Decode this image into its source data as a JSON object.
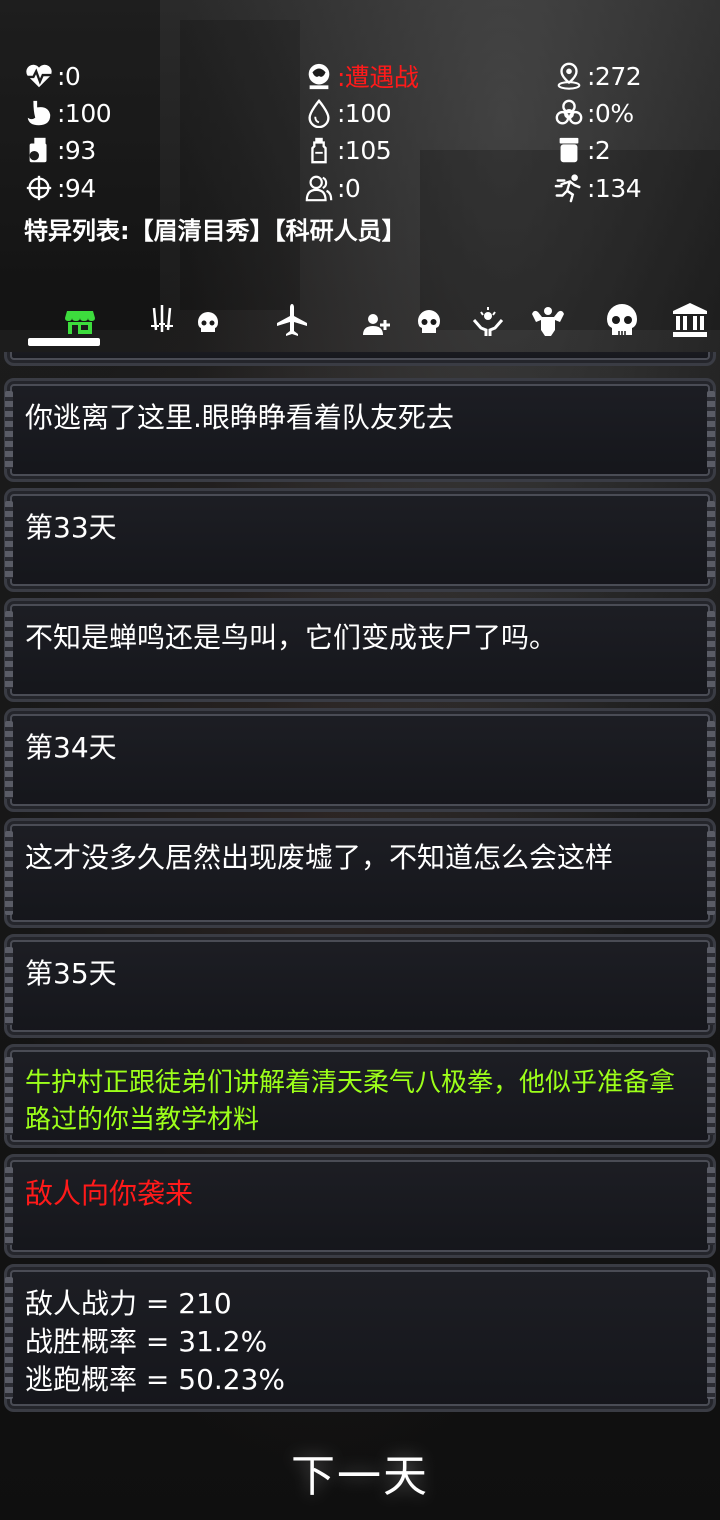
{
  "stats": {
    "health": ":0",
    "status": ":遭遇战",
    "distance": ":272",
    "hunger": ":100",
    "water": ":100",
    "infection": ":0%",
    "food": ":93",
    "drink": ":105",
    "medicine": ":2",
    "attack": ":94",
    "companions": ":0",
    "speed": ":134"
  },
  "traits": "特异列表:【眉清目秀】【科研人员】",
  "tabs": [
    "shop-icon",
    "weapons-skull-icon",
    "plane-icon",
    "add-user-skull-icon",
    "skull-icon",
    "hands-icon",
    "muscle-icon",
    "skull-large-icon",
    "bank-icon"
  ],
  "log": {
    "entry1": "你逃离了这里.眼睁睁看着队友死去",
    "day33": "第33天",
    "entry2": "不知是蝉鸣还是鸟叫，它们变成丧尸了吗。",
    "day34": "第34天",
    "entry3": "这才没多久居然出现废墟了，不知道怎么会这样",
    "day35": "第35天",
    "entry4": "牛护村正跟徒弟们讲解着清天柔气八极拳，他似乎准备拿路过的你当教学材料",
    "entry5": "敌人向你袭来",
    "enemy_power": "敌人战力 = 210",
    "win_rate": "战胜概率 = 31.2%",
    "escape_rate": "逃跑概率 = 50.23%"
  },
  "next_day_label": "下一天",
  "colors": {
    "alert_red": "#ff1a1a",
    "event_green": "#9dff1a",
    "active_tab_green": "#3ddc3d"
  }
}
